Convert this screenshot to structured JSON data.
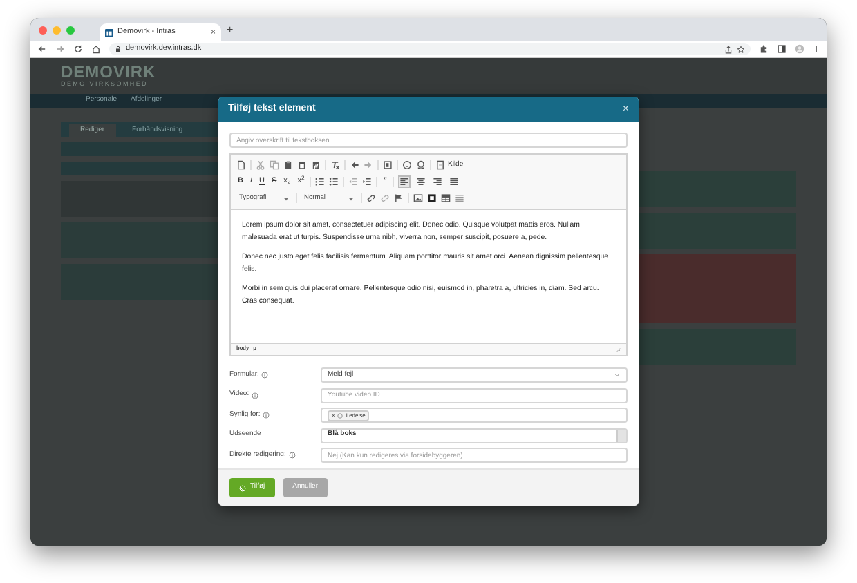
{
  "browser": {
    "tab_title": "Demovirk - Intras",
    "tab_close": "×",
    "new_tab": "+",
    "url": "demovirk.dev.intras.dk"
  },
  "page": {
    "logo": "DEMOVIRK",
    "logo_subtitle": "DEMO VIRKSOMHED",
    "nav": [
      "Personale",
      "Afdelinger"
    ],
    "tabs": [
      {
        "label": "Rediger",
        "selected": true
      },
      {
        "label": "Forhåndsvisning",
        "selected": false
      }
    ]
  },
  "modal": {
    "title": "Tilføj tekst element",
    "close": "×",
    "heading_placeholder": "Angiv overskrift til tekstboksen",
    "editor": {
      "source_label": "Kilde",
      "format_buttons": [
        "B",
        "I",
        "U",
        "S",
        "x$_{2}$",
        "x$^{2}$"
      ],
      "quote": "”",
      "alignment_buttons": [
        {
          "selected": true
        },
        {
          "selected": false
        },
        {
          "selected": false
        },
        {
          "selected": false
        }
      ],
      "dropdowns": [
        "Typografi",
        "Normal"
      ],
      "paragraphs": [
        "Lorem ipsum dolor sit amet, consectetuer adipiscing elit. Donec odio. Quisque volutpat mattis eros. Nullam malesuada erat ut turpis. Suspendisse urna nibh, viverra non, semper suscipit, posuere a, pede.",
        "Donec nec justo eget felis facilisis fermentum. Aliquam porttitor mauris sit amet orci. Aenean dignissim pellentesque felis.",
        "Morbi in sem quis dui placerat ornare. Pellentesque odio nisi, euismod in, pharetra a, ultricies in, diam. Sed arcu. Cras consequat."
      ],
      "path": [
        "body",
        "p"
      ]
    },
    "fields": [
      {
        "label": "Formular:",
        "has_info": true,
        "kind": "select",
        "value": "Meld fejl"
      },
      {
        "label": "Video:",
        "has_info": true,
        "kind": "input",
        "placeholder": "Youtube video ID."
      },
      {
        "label": "Synlig for:",
        "has_info": true,
        "kind": "tags",
        "tags": [
          "Ledelse"
        ],
        "tag_remove": "×"
      },
      {
        "label": "Udseende",
        "has_info": false,
        "kind": "scrollselect",
        "value": "Blå boks"
      },
      {
        "label": "Direkte redigering:",
        "has_info": true,
        "kind": "input",
        "placeholder": "Nej (Kan kun redigeres via forsidebyggeren)"
      }
    ],
    "buttons": [
      {
        "label": "Tilføj",
        "kind": "primary"
      },
      {
        "label": "Annuller",
        "kind": "secondary"
      }
    ]
  }
}
